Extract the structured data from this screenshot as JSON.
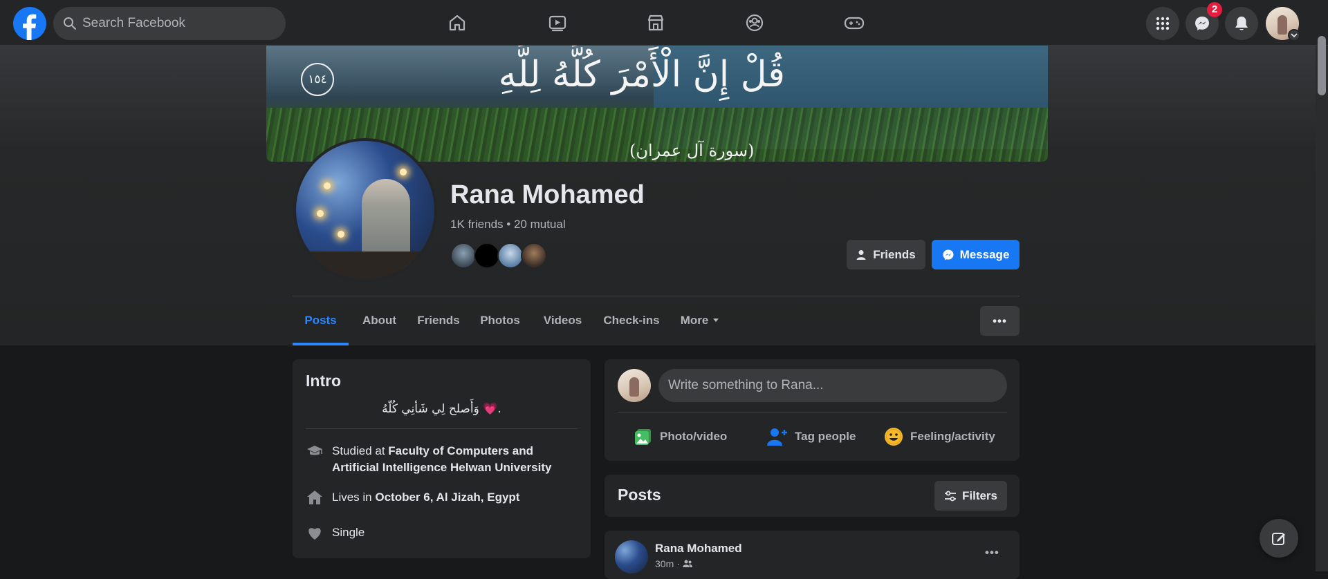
{
  "nav": {
    "search_placeholder": "Search Facebook",
    "messenger_badge": "2",
    "icons": [
      "home-icon",
      "watch-icon",
      "marketplace-icon",
      "groups-icon",
      "gaming-icon",
      "menu-grid-icon",
      "messenger-icon",
      "notifications-icon",
      "account-chevron-icon"
    ]
  },
  "cover": {
    "verse": "قُلْ إِنَّ الْأَمْرَ كُلَّهُ لِلَّهِ",
    "ayah_number": "١٥٤",
    "surah": "(سورة آل عمران)"
  },
  "profile": {
    "name": "Rana Mohamed",
    "friends_summary": "1K friends • 20 mutual",
    "friends_button": "Friends",
    "message_button": "Message"
  },
  "tabs": [
    {
      "label": "Posts",
      "active": true
    },
    {
      "label": "About"
    },
    {
      "label": "Friends"
    },
    {
      "label": "Photos"
    },
    {
      "label": "Videos"
    },
    {
      "label": "Check-ins"
    },
    {
      "label": "More"
    }
  ],
  "more_dots": "•••",
  "intro": {
    "title": "Intro",
    "bio": "وَأَصلح لِي شَأنِي كُلّهُ 💗.",
    "studied_prefix": "Studied at ",
    "studied_at": "Faculty of Computers and Artificial Intelligence Helwan University",
    "lives_prefix": "Lives in ",
    "lives_in": "October 6, Al Jizah, Egypt",
    "relationship": "Single"
  },
  "composer": {
    "placeholder": "Write something to Rana...",
    "actions": [
      "Photo/video",
      "Tag people",
      "Feeling/activity"
    ]
  },
  "posts": {
    "title": "Posts",
    "filters_button": "Filters",
    "first_post_author": "Rana Mohamed",
    "first_post_time": "30m",
    "first_post_more": "•••"
  },
  "colors": {
    "accent": "#1877f2",
    "active_tab": "#2d88ff",
    "badge": "#e41e3f",
    "surface": "#242526",
    "background": "#18191a"
  }
}
